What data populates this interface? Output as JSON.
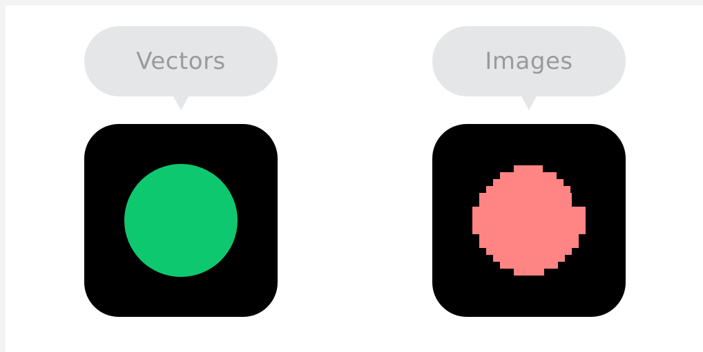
{
  "panels": [
    {
      "label": "Vectors",
      "shape_color": "#0ec870",
      "rendering": "smooth-circle"
    },
    {
      "label": "Images",
      "shape_color": "#ff8484",
      "rendering": "pixelated-circle"
    }
  ],
  "colors": {
    "bubble": "#e5e6e8",
    "label_text": "#9a9a9a",
    "tile": "#000000"
  }
}
